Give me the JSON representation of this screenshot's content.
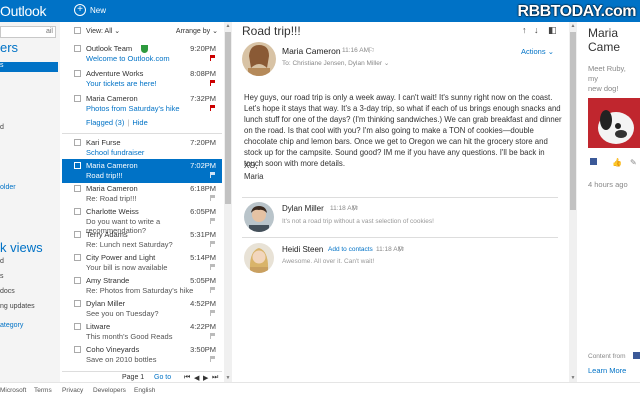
{
  "app": {
    "brand": "Outlook",
    "new_label": "New",
    "watermark": "RBBTODAY.com"
  },
  "nav": {
    "search_placeholder": "ail",
    "folders_heading": "ers",
    "folder_items": [
      "s",
      "",
      "",
      "d",
      "",
      "",
      "older"
    ],
    "quick_views_heading": "k views",
    "quick_items": [
      "d",
      "s",
      "docs",
      "ng updates",
      "ategory"
    ]
  },
  "list": {
    "view_label": "View: All",
    "arrange_label": "Arrange by",
    "flagged_label": "Flagged (3)",
    "hide_label": "Hide",
    "pinned": [
      {
        "sender": "Outlook Team",
        "subject": "Welcome to Outlook.com",
        "time": "9:20PM",
        "flag": "red",
        "blue": true
      },
      {
        "sender": "Adventure Works",
        "subject": "Your tickets are here!",
        "time": "8:08PM",
        "flag": "red",
        "blue": true
      },
      {
        "sender": "Maria Cameron",
        "subject": "Photos from Saturday's hike",
        "time": "7:32PM",
        "flag": "red",
        "blue": true
      }
    ],
    "messages": [
      {
        "sender": "Kari Furse",
        "subject": "School fundraiser",
        "time": "7:20PM",
        "flag": "none",
        "blue": true
      },
      {
        "sender": "Maria Cameron",
        "subject": "Road trip!!!",
        "time": "7:02PM",
        "flag": "grey",
        "selected": true
      },
      {
        "sender": "Maria Cameron",
        "subject": "Re: Road trip!!!",
        "time": "6:18PM",
        "flag": "grey"
      },
      {
        "sender": "Charlotte Weiss",
        "subject": "Do you want to write a recommendation?",
        "time": "6:05PM",
        "flag": "grey"
      },
      {
        "sender": "Terry Adams",
        "subject": "Re: Lunch next Saturday?",
        "time": "5:31PM",
        "flag": "grey"
      },
      {
        "sender": "City Power and Light",
        "subject": "Your bill is now available",
        "time": "5:14PM",
        "flag": "grey"
      },
      {
        "sender": "Amy Strande",
        "subject": "Re: Photos from Saturday's hike",
        "time": "5:05PM",
        "flag": "grey"
      },
      {
        "sender": "Dylan Miller",
        "subject": "See you on Tuesday?",
        "time": "4:52PM",
        "flag": "grey"
      },
      {
        "sender": "Litware",
        "subject": "This month's Good Reads",
        "time": "4:22PM",
        "flag": "grey"
      },
      {
        "sender": "Coho Vineyards",
        "subject": "Save on 2010 bottles",
        "time": "3:50PM",
        "flag": "grey"
      }
    ],
    "pager": {
      "page_label": "Page 1",
      "goto_label": "Go to"
    }
  },
  "reading": {
    "subject": "Road trip!!!",
    "sender": "Maria Cameron",
    "time": "11:16 AM",
    "to": "To: Christiane Jensen, Dylan Miller",
    "actions_label": "Actions",
    "body": [
      "Hey guys, our road trip is only a week away. I can't wait! It's sunny right now on the coast. Let's hope it stays that way. It's a 3-day trip, so what if each of us brings enough snacks and lunch stuff for one of the days? (I'm thinking sandwiches.) We can grab breakfast and dinner on the road. Is that cool with you? I'm also going to make a TON of cookies—double chocolate chip and lemon bars. Once we get to Oregon we can hit the grocery store and stock up for the campsite. Sound good? IM me if you have any questions. I'll be back in touch soon with more details.",
      "XO,",
      "Maria"
    ],
    "replies": [
      {
        "name": "Dylan Miller",
        "time": "11:18 AM",
        "text": "It's not a road trip without a vast selection of cookies!"
      },
      {
        "name": "Heidi Steen",
        "add_contact": "Add to contacts",
        "time": "11:18 AM",
        "text": "Awesome. All over it. Can't wait!"
      }
    ]
  },
  "people": {
    "name_line1": "Maria",
    "name_line2": "Came",
    "status_line1": "Meet Ruby,",
    "status_line2": "my",
    "status_line3": "new dog!",
    "ago": "4 hours ago",
    "content_from": "Content from",
    "learn_more": "Learn More",
    "learn_more2": "Learn"
  },
  "footer": {
    "items": [
      "Microsoft",
      "Terms",
      "Privacy",
      "Developers",
      "English"
    ]
  },
  "colors": {
    "accent": "#0072c6",
    "flag_red": "#cc0000",
    "verified_green": "#2e9a3e"
  }
}
